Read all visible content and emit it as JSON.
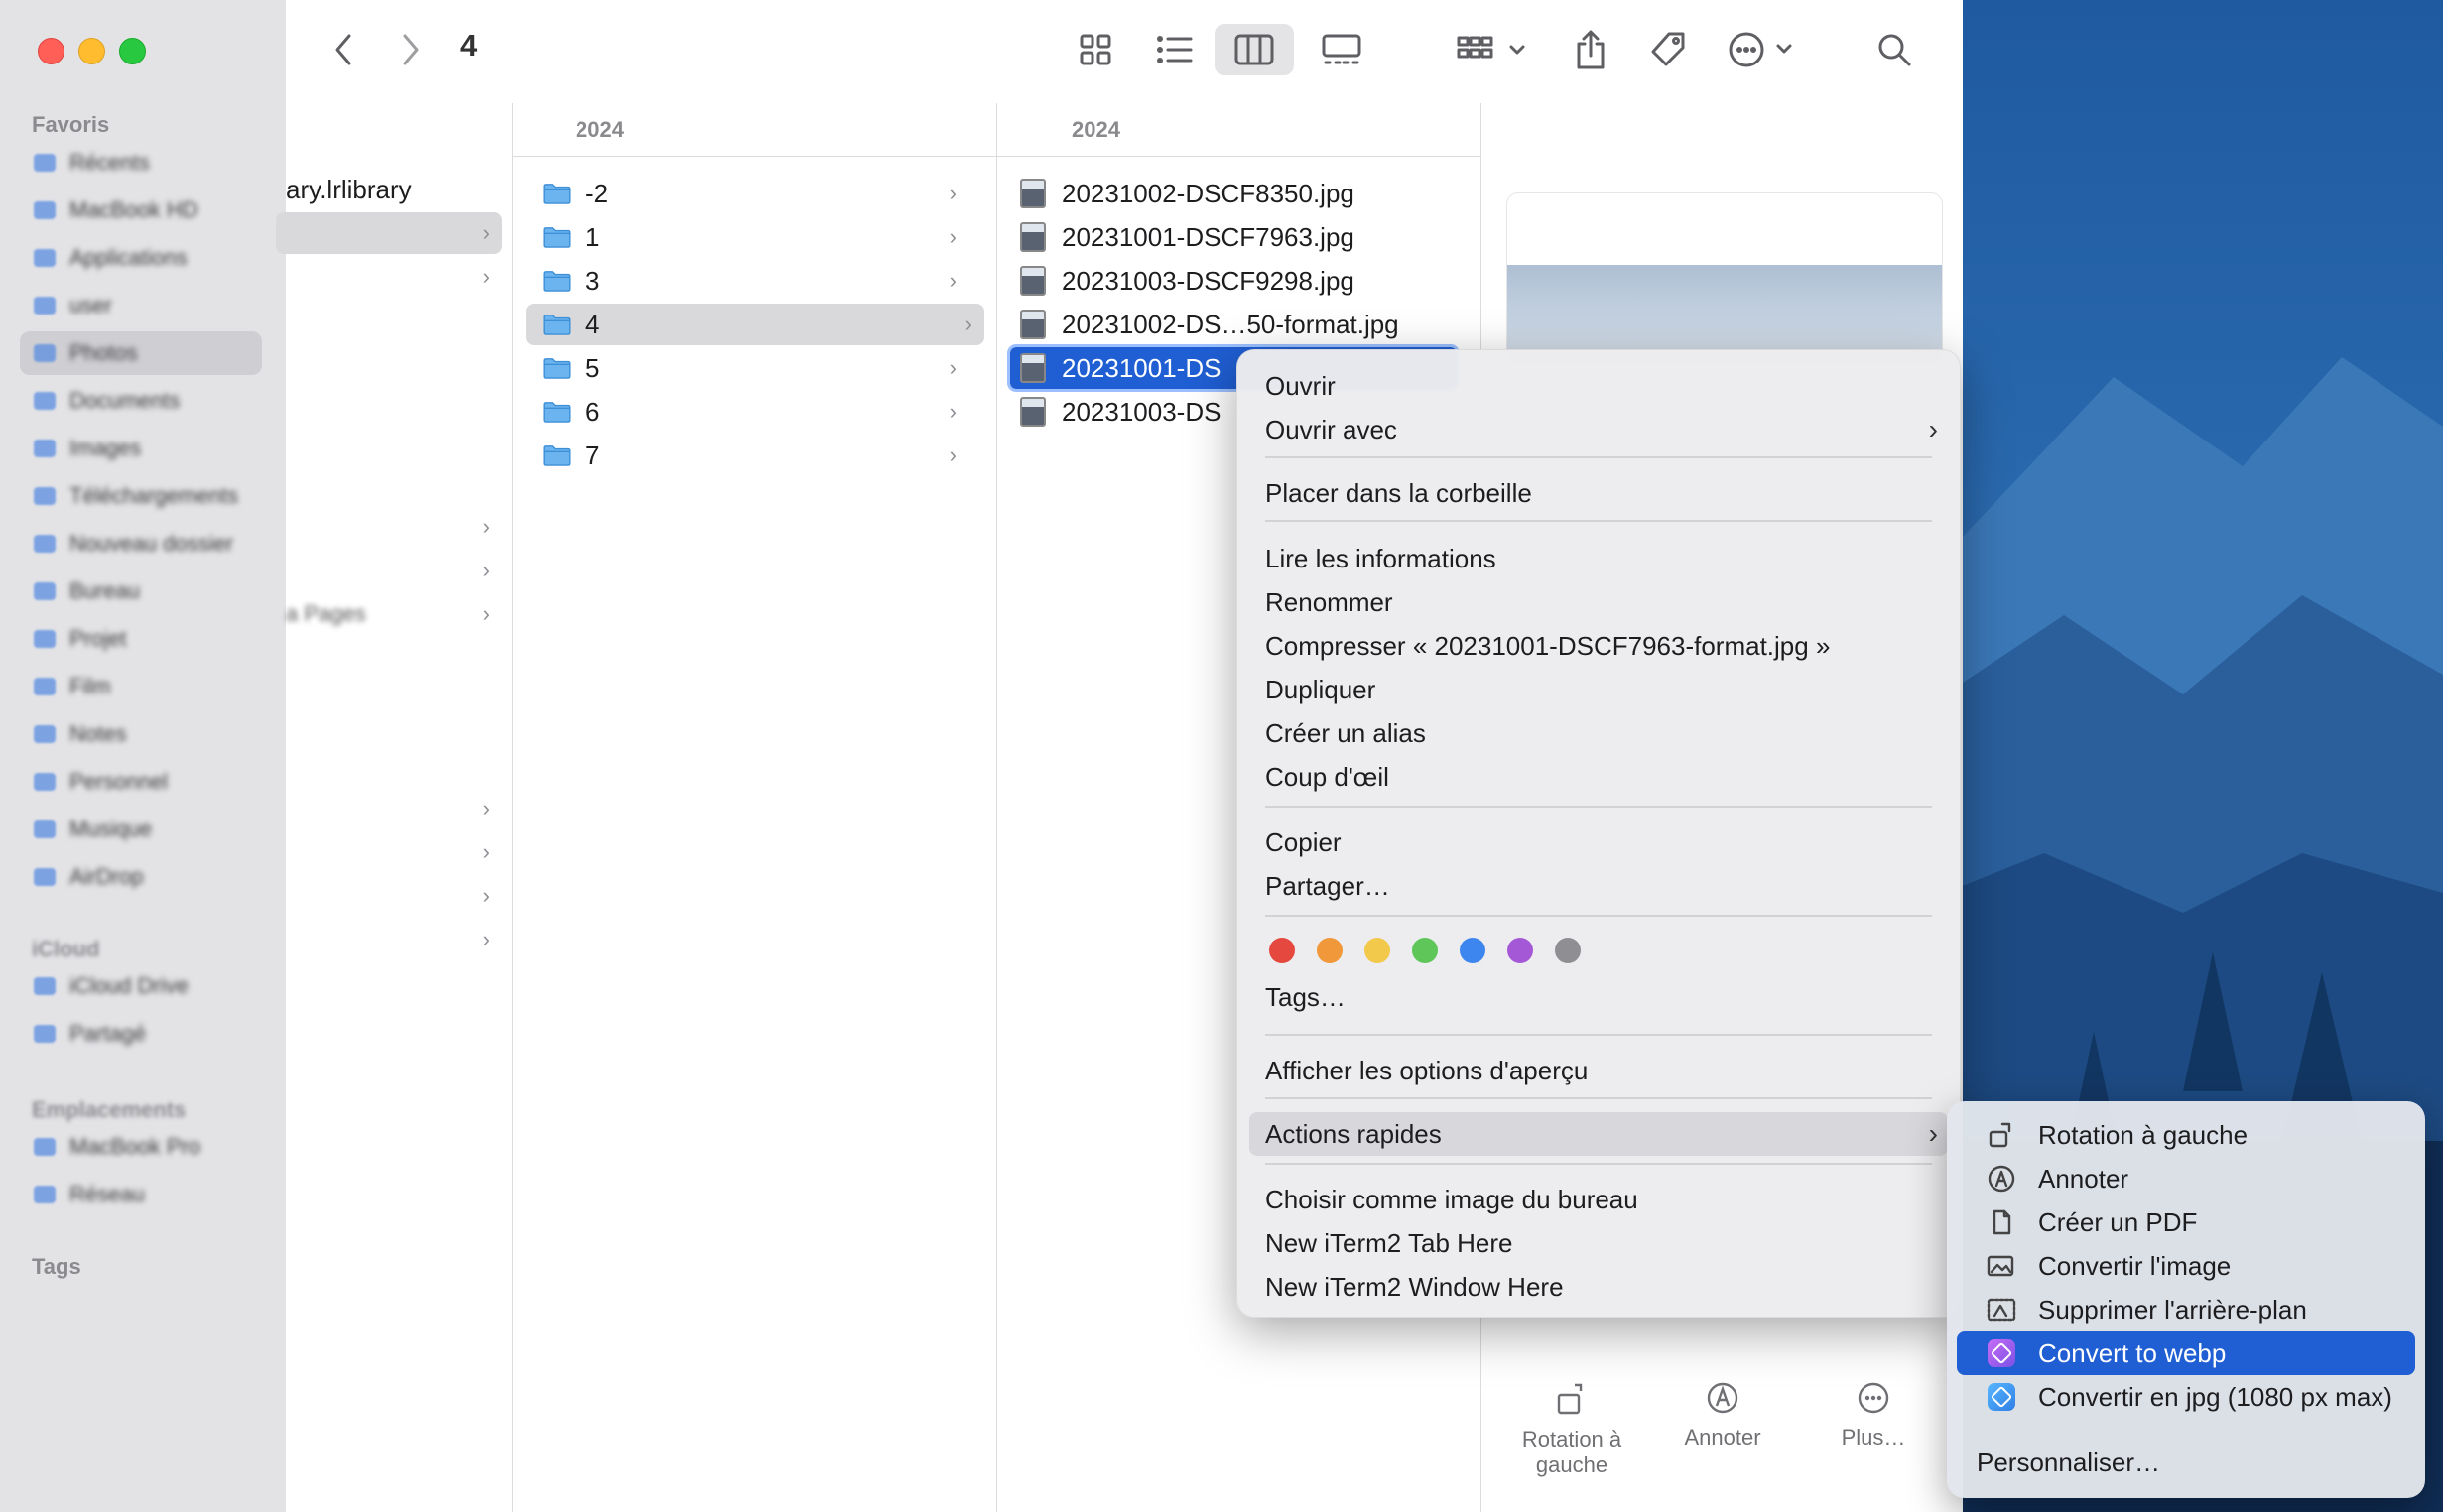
{
  "window": {
    "title": "4",
    "column_headers": [
      "2024",
      "2024"
    ],
    "column1_visible_text": "ary.lrlibrary"
  },
  "sidebar": {
    "favorites_label": "Favoris",
    "tags_label": "Tags"
  },
  "folders": [
    {
      "label": "-2",
      "selected": false
    },
    {
      "label": "1",
      "selected": false
    },
    {
      "label": "3",
      "selected": false
    },
    {
      "label": "4",
      "selected": true
    },
    {
      "label": "5",
      "selected": false
    },
    {
      "label": "6",
      "selected": false
    },
    {
      "label": "7",
      "selected": false
    }
  ],
  "files": [
    "20231002-DSCF8350.jpg",
    "20231001-DSCF7963.jpg",
    "20231003-DSCF9298.jpg",
    "20231002-DS…50-format.jpg",
    "20231001-DS",
    "20231003-DS"
  ],
  "preview_actions": {
    "rotate_left": "Rotation à gauche",
    "annotate": "Annoter",
    "more": "Plus…"
  },
  "context_menu": {
    "open": "Ouvrir",
    "open_with": "Ouvrir avec",
    "move_to_trash": "Placer dans la corbeille",
    "get_info": "Lire les informations",
    "rename": "Renommer",
    "compress": "Compresser « 20231001-DSCF7963-format.jpg »",
    "duplicate": "Dupliquer",
    "make_alias": "Créer un alias",
    "quick_look": "Coup d'œil",
    "copy": "Copier",
    "share": "Partager…",
    "tags": "Tags…",
    "show_view_options": "Afficher les options d'aperçu",
    "quick_actions": "Actions rapides",
    "set_desktop_picture": "Choisir comme image du bureau",
    "iterm_tab": "New iTerm2 Tab Here",
    "iterm_window": "New iTerm2 Window Here",
    "tag_colors": [
      "#e5483f",
      "#f0983a",
      "#f2c94a",
      "#5fc65a",
      "#3d86ef",
      "#a558d6",
      "#8e8e93"
    ]
  },
  "quick_actions_submenu": {
    "rotate_left": "Rotation à gauche",
    "annotate": "Annoter",
    "create_pdf": "Créer un PDF",
    "convert_image": "Convertir l'image",
    "remove_background": "Supprimer l'arrière-plan",
    "convert_webp": "Convert to webp",
    "convert_jpg": "Convertir en jpg (1080 px max)",
    "customize": "Personnaliser…"
  },
  "colors": {
    "selection_blue": "#1f5ed3",
    "folder_blue": "#4aa3e8"
  }
}
